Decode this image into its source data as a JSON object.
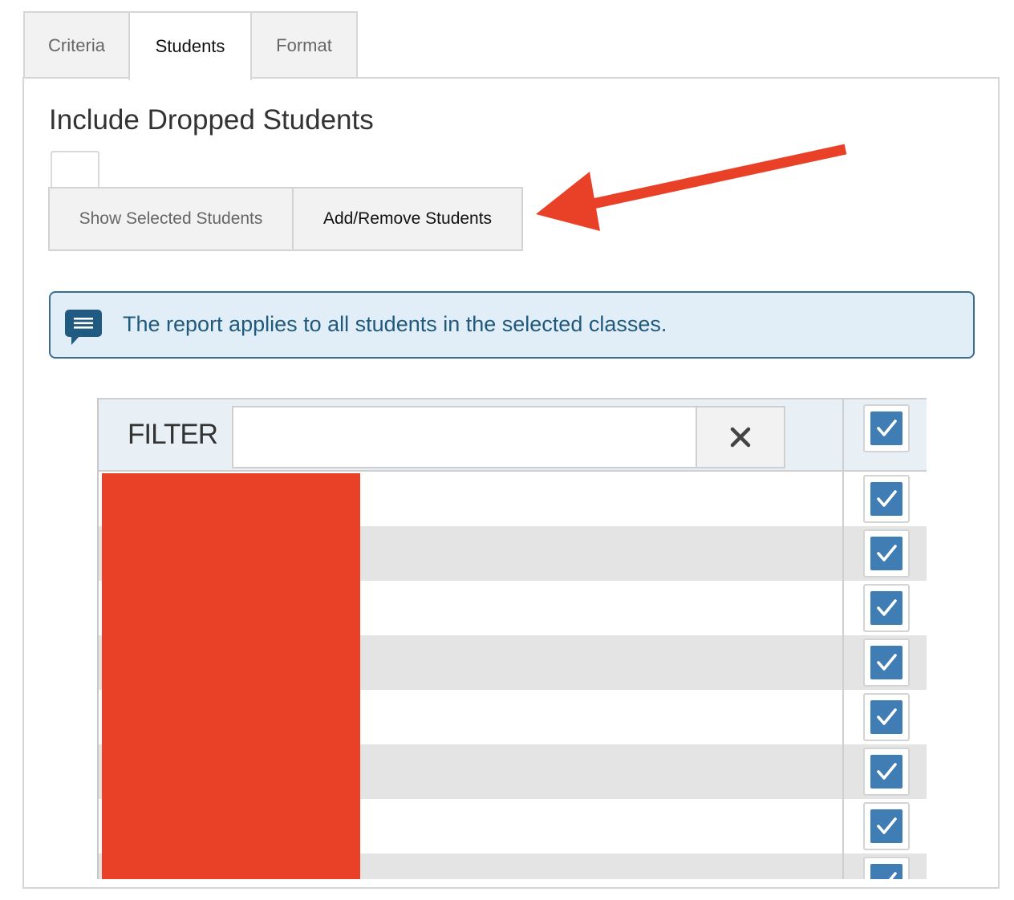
{
  "tabs": [
    {
      "label": "Criteria",
      "active": false
    },
    {
      "label": "Students",
      "active": true
    },
    {
      "label": "Format",
      "active": false
    }
  ],
  "section": {
    "title": "Include Dropped Students",
    "include_dropped_checked": false
  },
  "buttons": {
    "show_selected": "Show Selected Students",
    "add_remove": "Add/Remove Students"
  },
  "info": {
    "icon": "message-icon",
    "text": "The report applies to all students in the selected classes."
  },
  "filter": {
    "label": "FILTER",
    "value": "",
    "clear_icon": "close-icon"
  },
  "students": {
    "select_all_checked": true,
    "rows": [
      {
        "checked": true
      },
      {
        "checked": true
      },
      {
        "checked": true
      },
      {
        "checked": true
      },
      {
        "checked": true
      },
      {
        "checked": true
      },
      {
        "checked": true
      },
      {
        "checked": true
      }
    ],
    "names_redacted": true
  },
  "annotation": {
    "arrow_color": "#e94127",
    "points_to": "Add/Remove Students"
  },
  "colors": {
    "accent": "#3f7db4",
    "info_bg": "#e1eef8",
    "info_text": "#1f5a7d",
    "redaction": "#e94127"
  }
}
